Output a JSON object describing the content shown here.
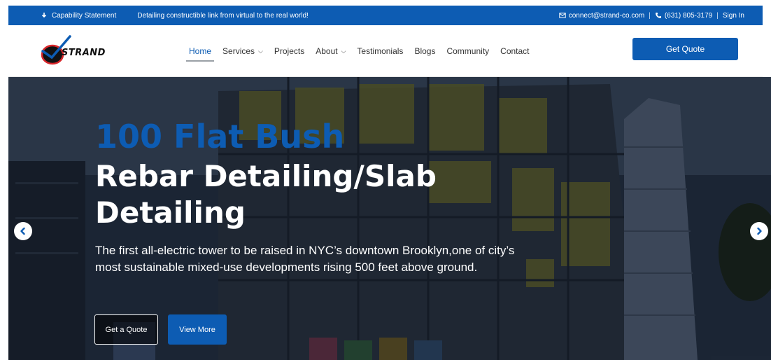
{
  "topbar": {
    "capability": "Capability Statement",
    "tagline": "Detailing constructible link from virtual to the real world!",
    "email": "connect@strand-co.com",
    "phone": "(631) 805-3179",
    "separator": "|",
    "signin": "Sign In"
  },
  "brand": {
    "name": "STRAND"
  },
  "nav": {
    "items": [
      {
        "label": "Home",
        "has_dropdown": false,
        "active": true
      },
      {
        "label": "Services",
        "has_dropdown": true
      },
      {
        "label": "Projects",
        "has_dropdown": false
      },
      {
        "label": "About",
        "has_dropdown": true
      },
      {
        "label": "Testimonials",
        "has_dropdown": false
      },
      {
        "label": "Blogs",
        "has_dropdown": false
      },
      {
        "label": "Community",
        "has_dropdown": false
      },
      {
        "label": "Contact",
        "has_dropdown": false
      }
    ],
    "quote_button": "Get Quote"
  },
  "hero": {
    "project": "100 Flat Bush",
    "headline": "Rebar Detailing/Slab Detailing",
    "description": "The first all-electric tower to be raised in NYC’s downtown Brooklyn,one of city’s most sustainable mixed-use developments rising 500 feet above ground.",
    "cta_primary": "Get a Quote",
    "cta_secondary": "View More"
  },
  "colors": {
    "brand_blue": "#0d5cb3",
    "white": "#ffffff",
    "text": "#333333"
  },
  "icons": [
    "download-icon",
    "mail-icon",
    "phone-icon",
    "chevron-down-icon",
    "chevron-left-icon",
    "chevron-right-icon",
    "strand-logo-icon"
  ]
}
